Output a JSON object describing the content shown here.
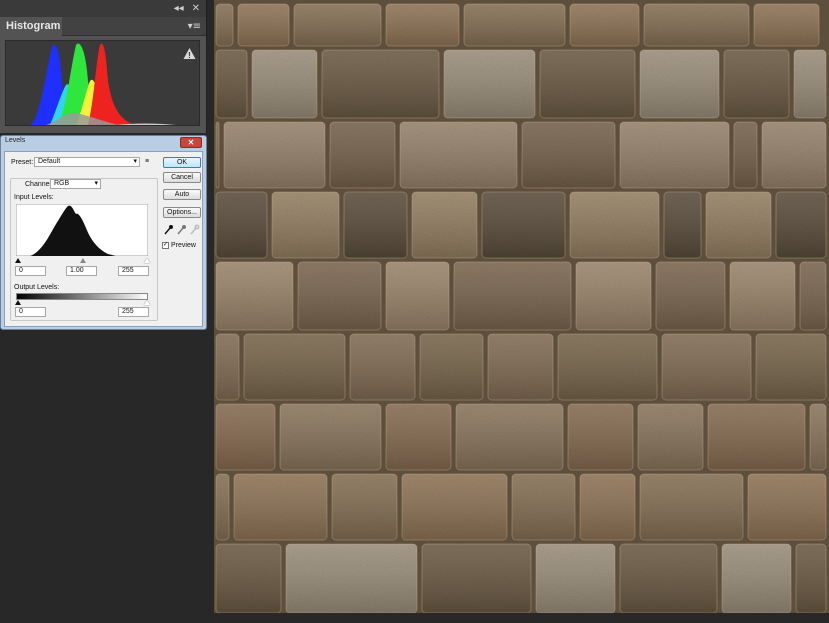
{
  "histogram_panel": {
    "tab_label": "Histogram",
    "collapse_glyph": "◂◂",
    "close_glyph": "✕",
    "menu_glyph": "▾≡",
    "warning_icon": "warning-icon",
    "warning_glyph": "!"
  },
  "levels_dialog": {
    "title": "Levels",
    "close_glyph": "✕",
    "preset_label": "Preset:",
    "preset_value": "Default",
    "channel_label": "Channel:",
    "channel_value": "RGB",
    "input_levels_label": "Input Levels:",
    "input_black": "0",
    "input_gamma": "1.00",
    "input_white": "255",
    "output_levels_label": "Output Levels:",
    "output_black": "0",
    "output_white": "255",
    "ok_label": "OK",
    "cancel_label": "Cancel",
    "auto_label": "Auto",
    "options_label": "Options...",
    "preview_label": "Preview",
    "preview_checked": true,
    "preset_menu_glyph": "≡",
    "dropdown_glyph": "▾",
    "checkbox_glyph": "✓"
  },
  "colors": {
    "app_background": "#282828",
    "panel": "#535353",
    "dialog_frame": "#b9cde5",
    "mortar": "#6b5a45"
  }
}
